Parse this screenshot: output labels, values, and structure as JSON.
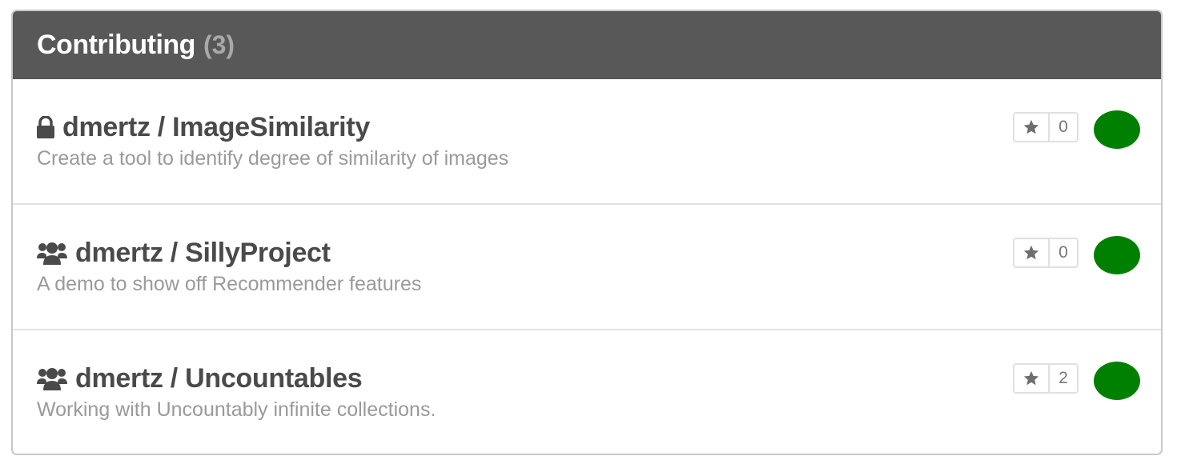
{
  "panel": {
    "title": "Contributing",
    "count": "(3)"
  },
  "repos": [
    {
      "name": "dmertz / ImageSimilarity",
      "description": "Create a tool to identify degree of similarity of images",
      "icon": "lock-icon",
      "stars": "0",
      "status_color": "#008000"
    },
    {
      "name": "dmertz / SillyProject",
      "description": "A demo to show off Recommender features",
      "icon": "users-icon",
      "stars": "0",
      "status_color": "#008000"
    },
    {
      "name": "dmertz / Uncountables",
      "description": "Working with Uncountably infinite collections.",
      "icon": "users-icon",
      "stars": "2",
      "status_color": "#008000"
    }
  ],
  "colors": {
    "header_bg": "#585858",
    "header_text": "#ffffff",
    "count_text": "#a8a8a8",
    "repo_name": "#4a4a4a",
    "description": "#9a9a9a",
    "status_ok": "#008000"
  }
}
